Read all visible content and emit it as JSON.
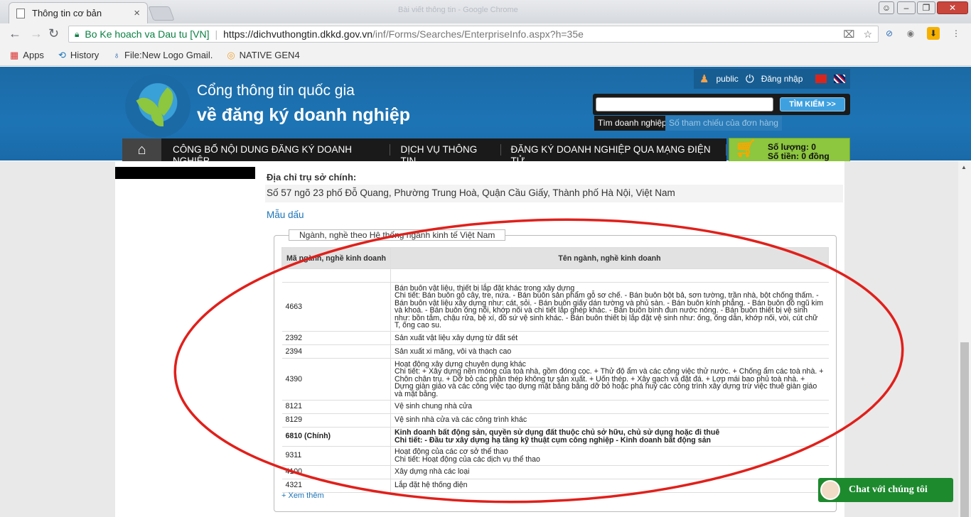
{
  "browser": {
    "tab_title": "Thông tin cơ bản",
    "tab_close": "×",
    "window_title": "Bài viết thông tin - Google Chrome",
    "site_name": "Bo Ke hoach va Dau tu [VN]",
    "url_host": "https://dichvuthongtin.dkkd.gov.vn",
    "url_path": "/inf/Forms/Searches/EnterpriseInfo.aspx?h=35e",
    "bookmarks": [
      {
        "label": "Apps"
      },
      {
        "label": "History"
      },
      {
        "label": "File:New Logo Gmail."
      },
      {
        "label": "NATIVE GEN4"
      }
    ]
  },
  "header": {
    "title_line1": "Cổng thông tin quốc gia",
    "title_line2": "về đăng ký doanh nghiệp",
    "user": "public",
    "login": "Đăng nhập",
    "search_placeholder": "",
    "search_button": "TÌM KIẾM >>",
    "search_tabs": [
      "Tìm doanh nghiệp",
      "Số tham chiếu của đơn hàng"
    ],
    "nav": [
      "CÔNG BỐ NỘI DUNG ĐĂNG KÝ DOANH NGHIỆP",
      "DỊCH VỤ THÔNG TIN",
      "ĐĂNG KÝ DOANH NGHIỆP QUA MẠNG ĐIỆN TỬ"
    ],
    "cart_qty": "Số lượng: 0",
    "cart_amount": "Số tiền: 0 đồng"
  },
  "enterprise": {
    "address_label": "Địa chỉ trụ sở chính:",
    "address_value": "Số 57 ngõ 23 phố Đỗ Quang, Phường Trung Hoà, Quận Cầu Giấy, Thành phố Hà Nội, Việt Nam",
    "seal_link": "Mẫu dấu",
    "section_legend": "Ngành, nghề theo Hệ thống ngành kinh tế Việt Nam",
    "columns": [
      "Mã ngành, nghề kinh doanh",
      "Tên ngành, nghề kinh doanh"
    ],
    "rows": [
      {
        "code": "",
        "lines": []
      },
      {
        "code": "4663",
        "lines": [
          "Bán buôn vật liệu, thiết bị lắp đặt khác trong xây dựng",
          "Chi tiết: Bán buôn gỗ cây, tre, nứa. - Bán buôn sản phẩm gỗ sơ chế. - Bán buôn bột bả, sơn tường, trần nhà, bột chống thấm. - Bán buôn vật liệu xây dựng như: cát, sỏi. - Bán buôn giấy dán tường và phủ sàn. - Bán buôn kính phẳng. - Bán buôn đồ ngũ kim và khoá. - Bán buôn ống nối, khớp nối và chi tiết lắp ghép khác. - Bán buôn bình đun nước nóng. - Bán buôn thiết bị vệ sinh như: bồn tắm, chậu rửa, bệ xí, đồ sứ vệ sinh khác. - Bán buôn thiết bị lắp đặt vệ sinh như: ống, ống dẫn, khớp nối, vòi, cút chữ T, ống cao su."
        ],
        "bold": false
      },
      {
        "code": "2392",
        "lines": [
          "Sản xuất vật liệu xây dựng từ đất sét"
        ],
        "bold": false
      },
      {
        "code": "2394",
        "lines": [
          "Sản xuất xi măng, vôi và thạch cao"
        ],
        "bold": false
      },
      {
        "code": "4390",
        "lines": [
          "Hoạt động xây dựng chuyên dụng khác",
          "Chi tiết: + Xây dựng nền móng của toà nhà, gồm đóng cọc. + Thử độ ẩm và các công việc thử nước. + Chống ẩm các toà nhà. + Chôn chân trụ. + Dỡ bỏ các phần thép không tự sản xuất. + Uốn thép. + Xây gạch và đặt đá. + Lợp mái bao phủ toà nhà. + Dựng giàn giáo và các công việc tạo dựng mặt bằng bằng dỡ bỏ hoặc phá huỷ các công trình xây dựng trừ việc thuê giàn giáo và mặt bằng."
        ],
        "bold": false
      },
      {
        "code": "8121",
        "lines": [
          "Vệ sinh chung nhà cửa"
        ],
        "bold": false
      },
      {
        "code": "8129",
        "lines": [
          "Vệ sinh nhà cửa và các công trình khác"
        ],
        "bold": false
      },
      {
        "code": "6810 (Chính)",
        "lines": [
          "Kinh doanh bất động sản, quyền sử dụng đất thuộc chủ sở hữu, chủ sử dụng hoặc đi thuê",
          "Chi tiết: - Đầu tư xây dựng hạ tầng kỹ thuật cụm công nghiệp - Kinh doanh bất động sản"
        ],
        "bold": true
      },
      {
        "code": "9311",
        "lines": [
          "Hoạt động của các cơ sở thể thao",
          "Chi tiết: Hoạt động của các dịch vụ thể thao"
        ],
        "bold": false
      },
      {
        "code": "4100",
        "lines": [
          "Xây dựng nhà các loại"
        ],
        "bold": false
      },
      {
        "code": "4321",
        "lines": [
          "Lắp đặt hệ thống điện"
        ],
        "bold": false
      }
    ],
    "more_link": "+ Xem thêm"
  },
  "chat": {
    "label": "Chat với chúng tôi"
  },
  "colors": {
    "header_blue": "#1d74b5",
    "cart_green": "#8dc63f",
    "annotation_red": "#e0201b",
    "chat_green": "#1d8a2e"
  }
}
